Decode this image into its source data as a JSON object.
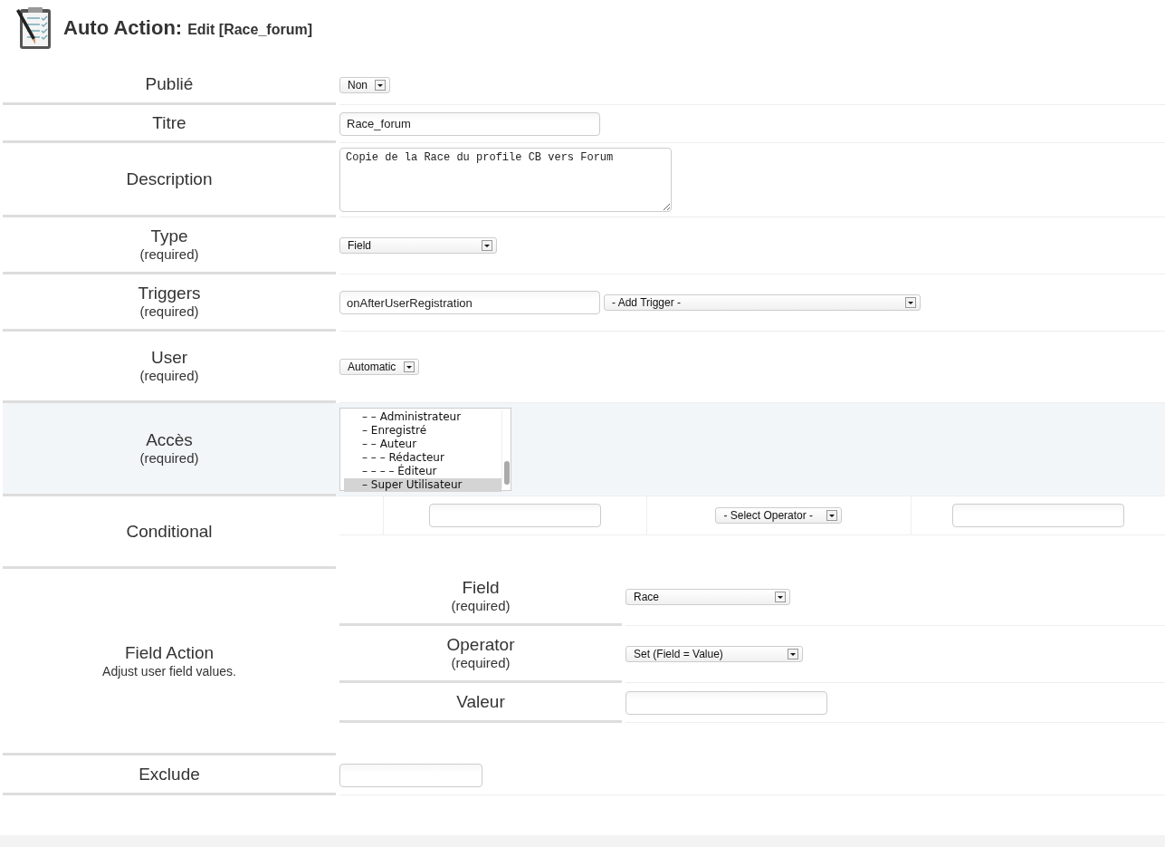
{
  "header": {
    "title": "Auto Action:",
    "subtitle": "Edit [Race_forum]"
  },
  "rows": [
    {
      "label": "Publié",
      "highlighted": false,
      "controls": [
        {
          "kind": "select",
          "value": "Non"
        }
      ]
    },
    {
      "label": "Titre",
      "highlighted": false,
      "controls": [
        {
          "kind": "text",
          "value": "Race_forum"
        }
      ]
    },
    {
      "label": "Description",
      "highlighted": false,
      "controls": [
        {
          "kind": "textarea",
          "value": "Copie de la Race du profile CB vers Forum"
        }
      ]
    },
    {
      "label": "Type",
      "note": "(required)",
      "highlighted": false,
      "controls": [
        {
          "kind": "select",
          "value": "Field"
        }
      ]
    },
    {
      "label": "Triggers",
      "note": "(required)",
      "highlighted": false,
      "controls": [
        {
          "kind": "text",
          "value": "onAfterUserRegistration"
        },
        {
          "kind": "select",
          "value": "- Add Trigger -"
        }
      ]
    },
    {
      "label": "User",
      "note": "(required)",
      "highlighted": false,
      "controls": [
        {
          "kind": "select",
          "value": "Automatic"
        }
      ]
    },
    {
      "label": "Accès",
      "note": "(required)",
      "highlighted": true,
      "controls": [
        {
          "kind": "listbox",
          "options": [
            {
              "label": "– – Administrateur",
              "selected": false
            },
            {
              "label": "– Enregistré",
              "selected": false
            },
            {
              "label": "– – Auteur",
              "selected": false
            },
            {
              "label": "– – – Rédacteur",
              "selected": false
            },
            {
              "label": "– – – – Éditeur",
              "selected": false
            },
            {
              "label": "– Super Utilisateur",
              "selected": true
            }
          ]
        }
      ]
    },
    {
      "label": "Conditional",
      "highlighted": false,
      "controls": [
        {
          "kind": "grid",
          "cells": [
            {
              "kind": "blank"
            },
            {
              "kind": "text"
            },
            {
              "kind": "select",
              "value": "- Select Operator -"
            },
            {
              "kind": "text"
            }
          ]
        }
      ]
    },
    {
      "label": "Field Action",
      "note": "Adjust user field values.",
      "highlighted": false,
      "controls": [
        {
          "kind": "subform",
          "rows": [
            {
              "label": "Field",
              "note": "(required)",
              "controls": [
                {
                  "kind": "select",
                  "value": "Race"
                }
              ]
            },
            {
              "label": "Operator",
              "note": "(required)",
              "controls": [
                {
                  "kind": "select",
                  "value": "Set (Field = Value)"
                }
              ]
            },
            {
              "label": "Valeur",
              "controls": [
                {
                  "kind": "text"
                }
              ]
            }
          ]
        }
      ]
    },
    {
      "label": "Exclude",
      "highlighted": false,
      "controls": [
        {
          "kind": "text"
        }
      ]
    }
  ]
}
